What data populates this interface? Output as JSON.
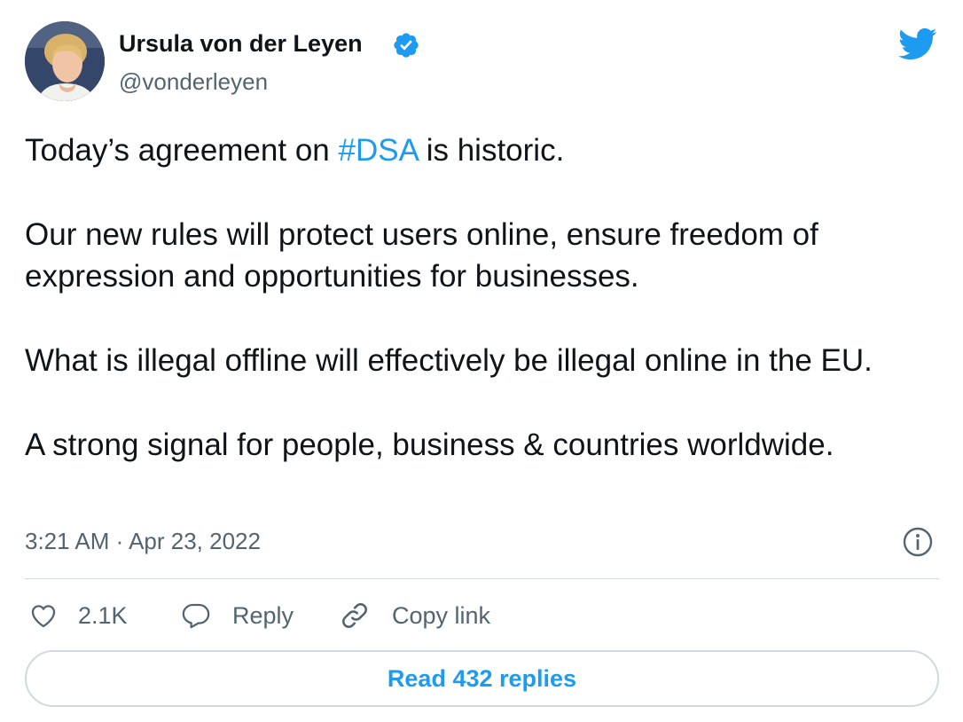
{
  "author": {
    "name": "Ursula von der Leyen",
    "handle": "@vonderleyen",
    "verified": true
  },
  "tweet": {
    "line1_before": "Today’s agreement on ",
    "line1_hashtag": "#DSA",
    "line1_after": " is historic.",
    "paragraph2": "Our new rules will protect users online, ensure freedom of expression and opportunities for businesses.",
    "paragraph3": "What is illegal offline will effectively be illegal online in the EU.",
    "paragraph4": "A strong signal for people, business & countries worldwide."
  },
  "timestamp": "3:21 AM · Apr 23, 2022",
  "actions": {
    "like_count": "2.1K",
    "reply_label": "Reply",
    "copy_link_label": "Copy link"
  },
  "read_replies_label": "Read 432 replies",
  "icons": {
    "verified": "verified-badge-icon",
    "logo": "twitter-bird-icon",
    "info": "info-icon",
    "like": "heart-icon",
    "reply": "speech-bubble-icon",
    "copy_link": "link-icon"
  },
  "colors": {
    "accent": "#1d9bf0",
    "text": "#0f1419",
    "secondary_text": "#536471",
    "border": "#cfd9de"
  }
}
